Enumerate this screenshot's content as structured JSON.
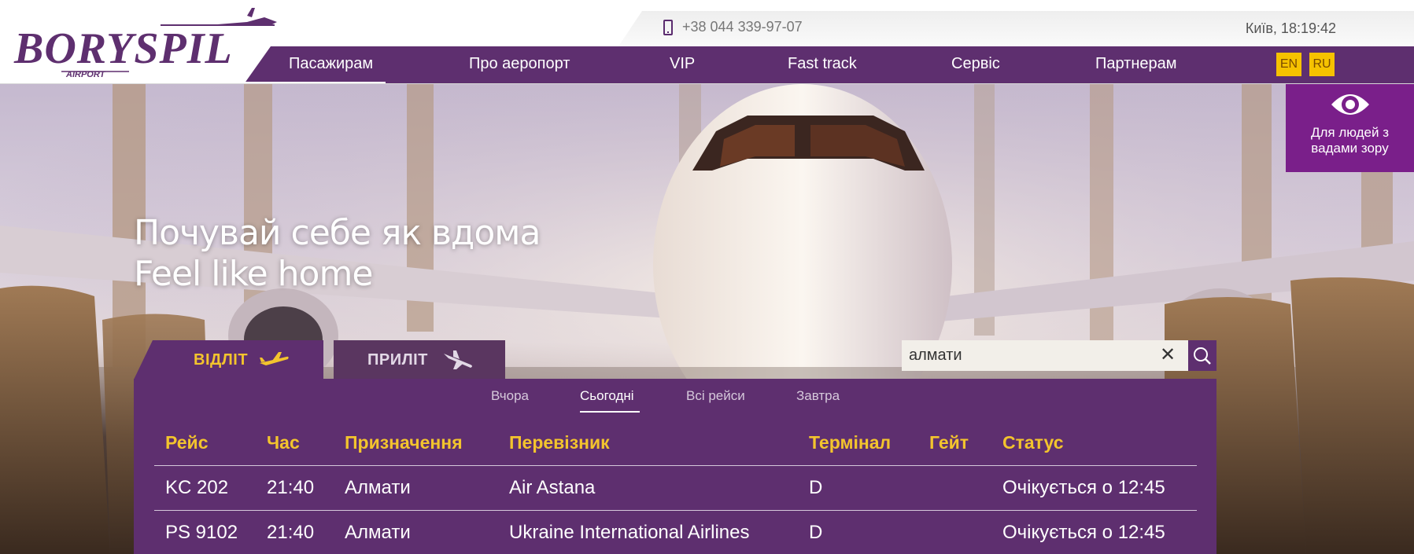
{
  "header": {
    "logo_text": "BORYSPIL",
    "logo_subtext": "AIRPORT",
    "phone": "+38 044 339-97-07",
    "clock": "Київ, 18:19:42"
  },
  "nav": {
    "items": [
      {
        "label": "Пасажирам"
      },
      {
        "label": "Про аеропорт"
      },
      {
        "label": "VIP"
      },
      {
        "label": "Fast track"
      },
      {
        "label": "Сервіс"
      },
      {
        "label": "Партнерам"
      }
    ],
    "languages": [
      "EN",
      "RU"
    ]
  },
  "accessibility": {
    "label_line1": "Для людей з",
    "label_line2": "вадами зору",
    "icon": "eye-icon"
  },
  "hero": {
    "title_line1": "Почувай себе як вдома",
    "title_line2": "Feel like home"
  },
  "board": {
    "tabs": [
      {
        "label": "ВІДЛІТ",
        "icon": "plane-takeoff-icon",
        "active": true
      },
      {
        "label": "ПРИЛІТ",
        "icon": "plane-landing-icon",
        "active": false
      }
    ],
    "search": {
      "value": "алмати"
    },
    "days": [
      {
        "label": "Вчора",
        "active": false
      },
      {
        "label": "Сьогодні",
        "active": true
      },
      {
        "label": "Всі рейси",
        "active": false
      },
      {
        "label": "Завтра",
        "active": false
      }
    ],
    "columns": [
      "Рейс",
      "Час",
      "Призначення",
      "Перевізник",
      "Термінал",
      "Гейт",
      "Статус"
    ],
    "rows": [
      {
        "flight": "KC 202",
        "time": "21:40",
        "destination": "Алмати",
        "carrier": "Air Astana",
        "terminal": "D",
        "gate": "",
        "status": "Очікується о 12:45"
      },
      {
        "flight": "PS 9102",
        "time": "21:40",
        "destination": "Алмати",
        "carrier": "Ukraine International Airlines",
        "terminal": "D",
        "gate": "",
        "status": "Очікується о 12:45"
      }
    ]
  },
  "colors": {
    "brand_purple": "#5e2f6f",
    "accent_yellow": "#f3c42d",
    "accessibility_purple": "#7a1f8a",
    "lang_yellow": "#f6c200"
  }
}
